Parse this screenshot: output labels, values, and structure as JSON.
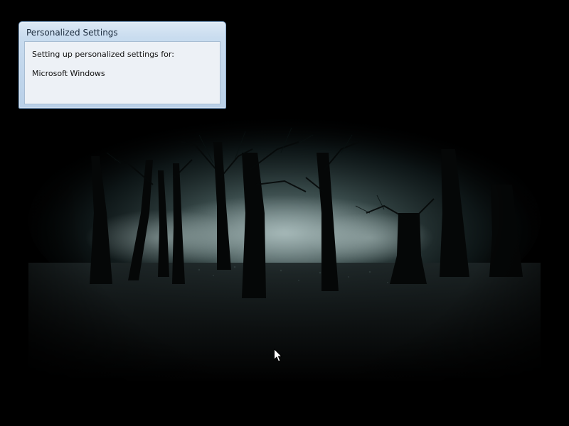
{
  "dialog": {
    "title": "Personalized Settings",
    "message": "Setting up personalized settings for:",
    "component": "Microsoft Windows"
  },
  "desktop": {
    "wallpaper": "dark-misty-forest",
    "background_color": "#000000"
  },
  "icons": {
    "cursor": "mouse-pointer-icon"
  }
}
